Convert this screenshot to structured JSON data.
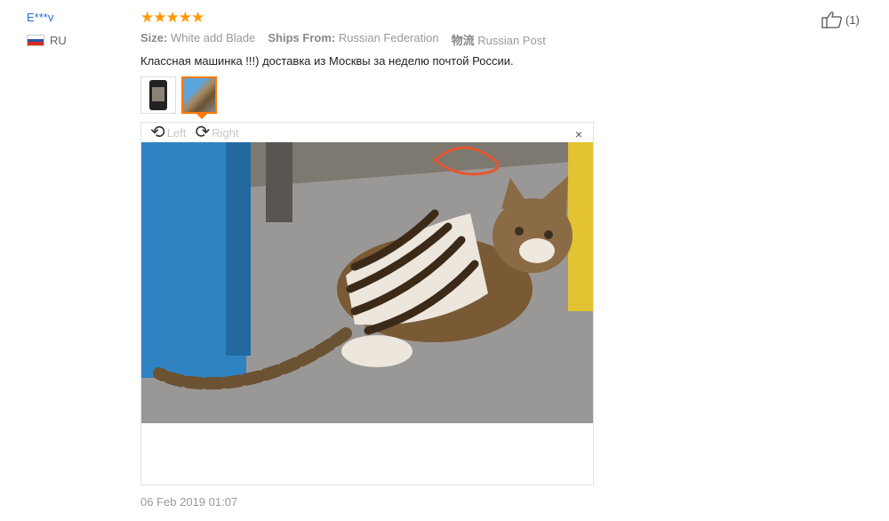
{
  "review": {
    "user": "E***v",
    "country": "RU",
    "stars": "★★★★★",
    "rating": 5,
    "meta": [
      {
        "label": "Size:",
        "value": "White add Blade"
      },
      {
        "label": "Ships From:",
        "value": "Russian Federation"
      },
      {
        "label": "物流",
        "value": "Russian Post"
      }
    ],
    "comment": "Классная машинка !!!) доставка из Москвы за неделю почтой России.",
    "viewer": {
      "rotate_left": "Left",
      "rotate_right": "Right",
      "close": "×"
    },
    "date": "06 Feb 2019 01:07",
    "like_count": "(1)"
  },
  "colors": {
    "stars": "#ff9900",
    "user": "#2a6ccf",
    "active_thumb": "#ff7a00"
  }
}
